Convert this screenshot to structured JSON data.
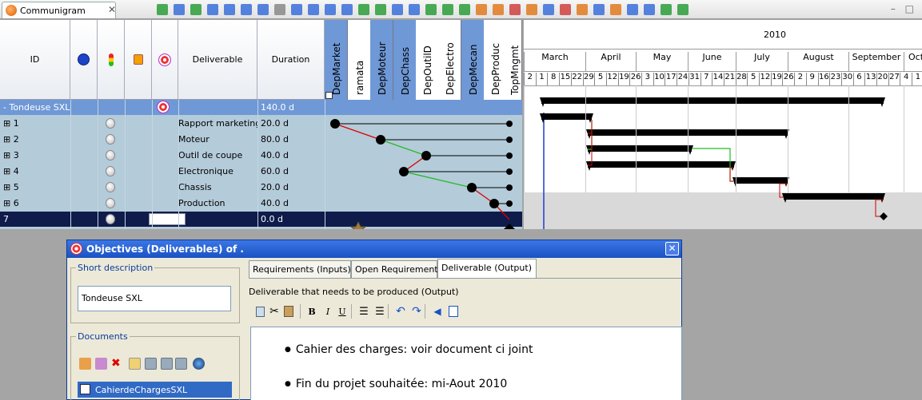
{
  "tab": {
    "title": "Communigram",
    "close": "✕"
  },
  "window_controls": "– □",
  "columns": {
    "id": "ID",
    "deliverable": "Deliverable",
    "duration": "Duration",
    "departments": [
      "DepMarket",
      "ramata",
      "DepMoteur",
      "DepChass",
      "DepOutilD",
      "DepElectro",
      "DepMecan",
      "DepProduc",
      "TopMngmt"
    ]
  },
  "rows": [
    {
      "id": "- Tondeuse SXL",
      "deliverable": "",
      "duration": "140.0 d",
      "type": "summary"
    },
    {
      "id": "⊞ 1",
      "deliverable": "Rapport marketing",
      "duration": "20.0 d",
      "type": "task"
    },
    {
      "id": "⊞ 2",
      "deliverable": "Moteur",
      "duration": "80.0 d",
      "type": "task"
    },
    {
      "id": "⊞ 3",
      "deliverable": "Outil de coupe",
      "duration": "40.0 d",
      "type": "task"
    },
    {
      "id": "⊞ 4",
      "deliverable": "Electronique",
      "duration": "60.0 d",
      "type": "task"
    },
    {
      "id": "⊞ 5",
      "deliverable": "Chassis",
      "duration": "20.0 d",
      "type": "task"
    },
    {
      "id": "⊞ 6",
      "deliverable": "Production",
      "duration": "40.0 d",
      "type": "task"
    },
    {
      "id": "7",
      "deliverable": "",
      "duration": "0.0 d",
      "type": "milestone"
    }
  ],
  "gantt": {
    "year": "2010",
    "months": [
      "March",
      "April",
      "May",
      "June",
      "July",
      "August",
      "September",
      "Oct"
    ],
    "days": [
      "2",
      "1",
      "8",
      "15",
      "22",
      "29",
      "5",
      "12",
      "19",
      "26",
      "3",
      "10",
      "17",
      "24",
      "31",
      "7",
      "14",
      "21",
      "28",
      "5",
      "12",
      "19",
      "26",
      "2",
      "9",
      "16",
      "23",
      "30",
      "6",
      "13",
      "20",
      "27",
      "4",
      "1"
    ]
  },
  "dialog": {
    "title": "Objectives (Deliverables) of .",
    "close": "✕",
    "short_description_label": "Short description",
    "short_description_value": "Tondeuse SXL",
    "documents_label": "Documents",
    "document_item": "CahierdeChargesSXL",
    "tabs": [
      "Requirements (Inputs)",
      "Open Requirements",
      "Deliverable (Output)"
    ],
    "panel_caption": "Deliverable that needs to be produced (Output)",
    "format": {
      "bold": "B",
      "italic": "I",
      "underline": "U"
    },
    "bullets": [
      "Cahier des charges:  voir document ci joint",
      "Fin du projet souhaitée: mi-Aout 2010"
    ]
  },
  "colors": {
    "accent": "#1a52c4",
    "grid_bg": "#b4cbd9",
    "selected_row": "#0f1b4a"
  }
}
